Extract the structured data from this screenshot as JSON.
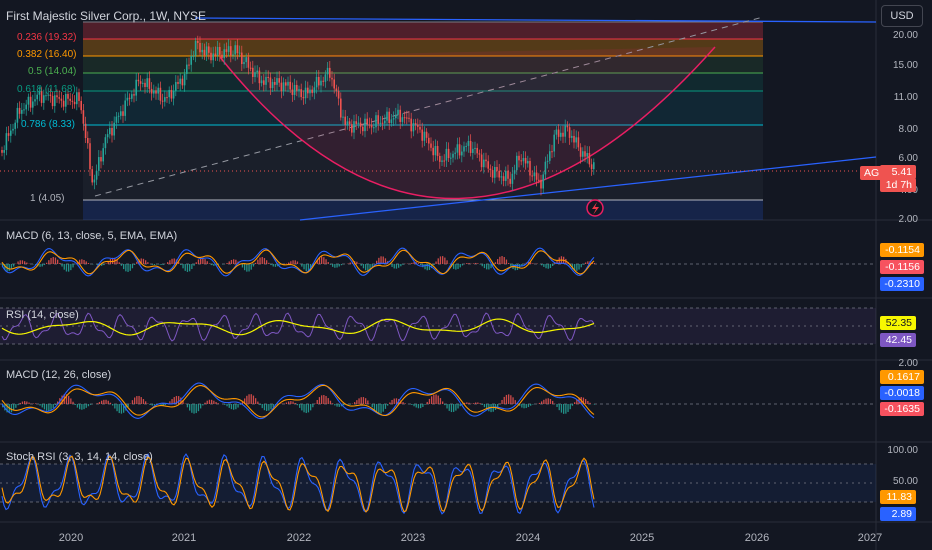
{
  "header": {
    "title": "First Majestic Silver Corp., 1W, NYSE",
    "currency": "USD"
  },
  "symbol": {
    "ticker": "AG",
    "price": "5.41",
    "countdown": "1d 7h"
  },
  "price_axis": {
    "ticks": [
      "20.00",
      "15.00",
      "11.00",
      "8.00",
      "6.00",
      "4.00",
      "2.00"
    ]
  },
  "fib_levels": [
    {
      "label": "0.236 (19.32)",
      "color": "#f23645"
    },
    {
      "label": "0.382 (16.40)",
      "color": "#ff9800"
    },
    {
      "label": "0.5 (14.04)",
      "color": "#4caf50"
    },
    {
      "label": "0.618 (11.68)",
      "color": "#089981"
    },
    {
      "label": "0.786 (8.33)",
      "color": "#00bcd4"
    },
    {
      "label": "1 (4.05)",
      "color": "#b2b5be"
    }
  ],
  "indicators": {
    "macd_fast": {
      "label": "MACD (6, 13, close, 5, EMA, EMA)",
      "values": [
        "-0.1154",
        "-0.1156",
        "-0.2310"
      ],
      "colors": [
        "#ff9800",
        "#f7525f",
        "#2962ff"
      ]
    },
    "rsi": {
      "label": "RSI (14, close)",
      "values": [
        "52.35",
        "42.45"
      ],
      "colors": [
        "#f7f700",
        "#7e57c2"
      ]
    },
    "macd": {
      "label": "MACD (12, 26, close)",
      "axis_top": "2.00",
      "values": [
        "0.1617",
        "-0.0018",
        "-0.1635"
      ],
      "colors": [
        "#ff9800",
        "#2962ff",
        "#f7525f"
      ]
    },
    "stoch_rsi": {
      "label": "Stoch RSI (3, 3, 14, 14, close)",
      "ticks": [
        "100.00",
        "50.00"
      ],
      "values": [
        "11.83",
        "2.89"
      ],
      "colors": [
        "#ff9800",
        "#2962ff"
      ]
    }
  },
  "time_axis": {
    "labels": [
      "2020",
      "2021",
      "2022",
      "2023",
      "2024",
      "2025",
      "2026",
      "2027"
    ]
  },
  "colors": {
    "background": "#131722",
    "up": "#26a69a",
    "down": "#ef5350",
    "trendline": "#2962ff",
    "arc": "#e91e63"
  },
  "icons": [
    "lightning-event-icon"
  ]
}
